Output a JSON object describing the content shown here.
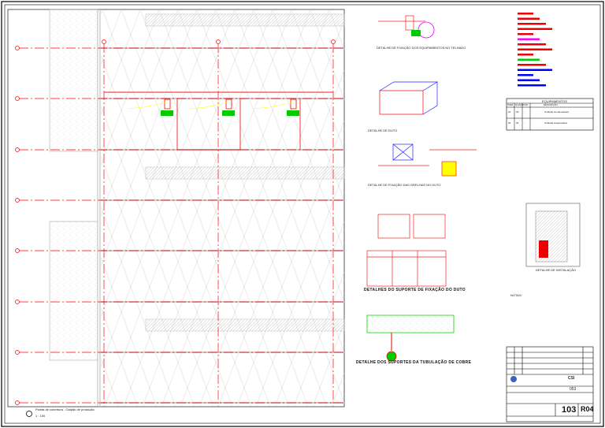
{
  "sheet": {
    "plan_title": "Planta de cobertura - Galpão de produção",
    "plan_scale": "1 : 100",
    "detail_duct_caption": "DETALHES DO SUPORTE DE FIXAÇÃO DO DUTO",
    "detail_copper_caption": "DETALHE DOS SUPORTES DA TUBULAÇÃO DE COBRE",
    "detail_top_caption": "DETALHE DE FIXAÇÃO DOS EQUIPAMENTOS NO TELHADO",
    "detail_iso_caption": "DETALHE DE DUTO",
    "detail_grille_caption": "DETALHE DE FIXAÇÃO DAS GRELHAS NO DUTO",
    "detail_elev_caption": "DETALHE DE INSTALAÇÃO",
    "equipment_table_title": "EQUIPAMENTOS",
    "equipment_headers": [
      "ITEM",
      "QUANT.",
      "CAP.",
      "DESCRIÇÃO"
    ],
    "equipment_rows": [
      [
        "01",
        "03",
        "-",
        "Unidade condensadora"
      ],
      [
        "02",
        "03",
        "-",
        "Unidade evaporadora"
      ]
    ],
    "notes_title": "NOTAS:",
    "sheet_number": "103",
    "revision": "R04",
    "title_code": "053"
  },
  "colors": {
    "grid": "#ff0000",
    "equipment": "#00cc00",
    "annotation": "#ffff00",
    "structure": "#bbbbbb"
  }
}
